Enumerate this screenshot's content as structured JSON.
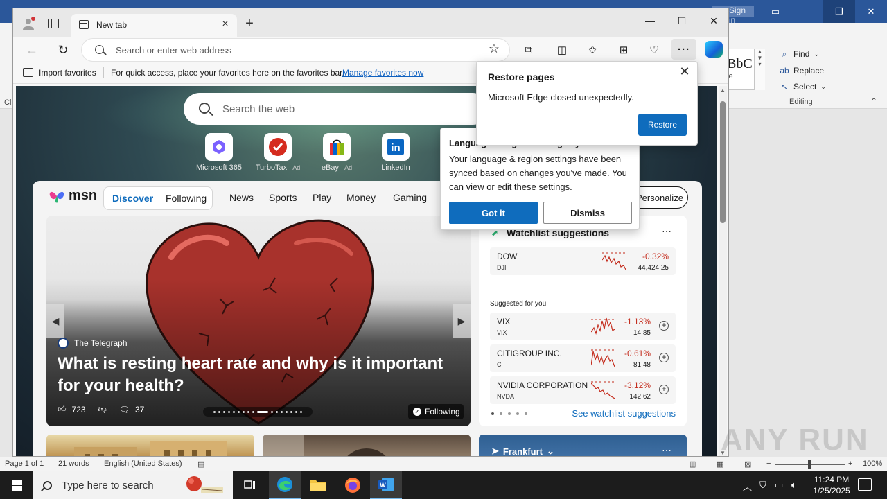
{
  "word": {
    "signin_label": "Sign in",
    "editing": {
      "find": "Find",
      "replace": "Replace",
      "select": "Select",
      "group_label": "Editing"
    },
    "styles_preview": "BbC",
    "styles_sub": "le",
    "left_cut_label": "Cl",
    "status": {
      "page": "Page 1 of 1",
      "words": "21 words",
      "language": "English (United States)",
      "zoom": "100%"
    }
  },
  "edge": {
    "tab_title": "New tab",
    "address_placeholder": "Search or enter web address",
    "favorites_bar": {
      "import_label": "Import favorites",
      "message": "For quick access, place your favorites here on the favorites bar.",
      "manage_link": "Manage favorites now"
    }
  },
  "ntp": {
    "search_placeholder": "Search the web",
    "quick_links": [
      {
        "label": "Microsoft 365",
        "ad": ""
      },
      {
        "label": "TurboTax",
        "ad": "· Ad"
      },
      {
        "label": "eBay",
        "ad": "· Ad"
      },
      {
        "label": "LinkedIn",
        "ad": ""
      }
    ],
    "feed": {
      "brand": "msn",
      "pills": [
        "Discover",
        "Following"
      ],
      "nav": [
        "News",
        "Sports",
        "Play",
        "Money",
        "Gaming"
      ],
      "personalize": "Personalize"
    },
    "hero": {
      "source": "The Telegraph",
      "headline": "What is resting heart rate and why is it important for your health?",
      "likes": "723",
      "comments": "37",
      "follow_label": "Following"
    },
    "watchlist": {
      "title": "Watchlist suggestions",
      "suggested_label": "Suggested for you",
      "link": "See watchlist suggestions",
      "primary": {
        "name": "DOW",
        "symbol": "DJI",
        "change": "-0.32%",
        "value": "44,424.25"
      },
      "suggestions": [
        {
          "name": "VIX",
          "symbol": "VIX",
          "change": "-1.13%",
          "value": "14.85"
        },
        {
          "name": "CITIGROUP INC.",
          "symbol": "C",
          "change": "-0.61%",
          "value": "81.48"
        },
        {
          "name": "NVIDIA CORPORATION",
          "symbol": "NVDA",
          "change": "-3.12%",
          "value": "142.62"
        }
      ]
    },
    "weather_title": "Frankfurt"
  },
  "restore_popup": {
    "title": "Restore pages",
    "body": "Microsoft Edge closed unexpectedly.",
    "button": "Restore"
  },
  "language_popup": {
    "title": "Language & region settings synced",
    "body": "Your language & region settings have been synced based on changes you've made. You can view or edit these settings.",
    "got_it": "Got it",
    "dismiss": "Dismiss"
  },
  "taskbar": {
    "search_placeholder": "Type here to search",
    "time": "11:24 PM",
    "date": "1/25/2025"
  },
  "watermark": "ANY RUN",
  "colors": {
    "word_blue": "#2b579a",
    "edge_accent": "#0f6cbd",
    "negative": "#c42b1c"
  }
}
